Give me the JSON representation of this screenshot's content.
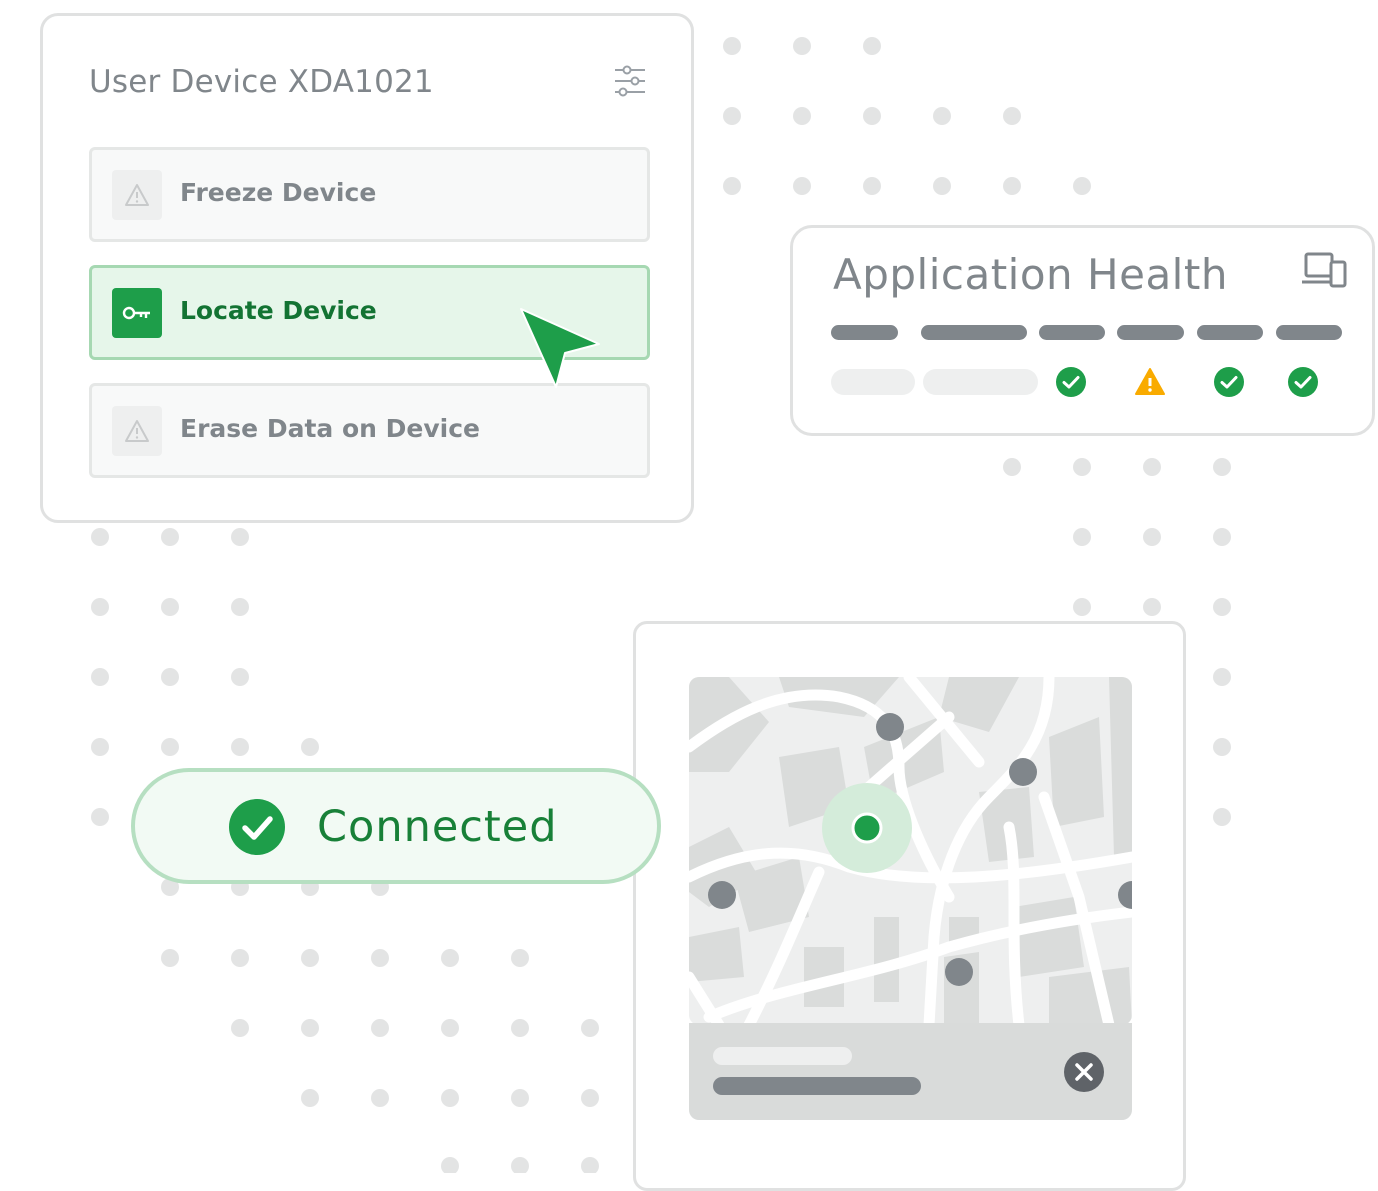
{
  "device_card": {
    "title": "User Device XDA1021",
    "actions": [
      {
        "label": "Freeze Device",
        "icon": "warning-icon",
        "selected": false
      },
      {
        "label": "Locate Device",
        "icon": "key-icon",
        "selected": true
      },
      {
        "label": "Erase Data on Device",
        "icon": "warning-icon",
        "selected": false
      }
    ]
  },
  "health_card": {
    "title": "Application Health",
    "statuses": [
      "ok",
      "warning",
      "ok",
      "ok"
    ]
  },
  "connection": {
    "status_label": "Connected"
  },
  "colors": {
    "accent_green": "#1e9e4a",
    "text_green": "#137333",
    "warning_amber": "#f9ab00",
    "neutral_gray": "#80868b"
  }
}
